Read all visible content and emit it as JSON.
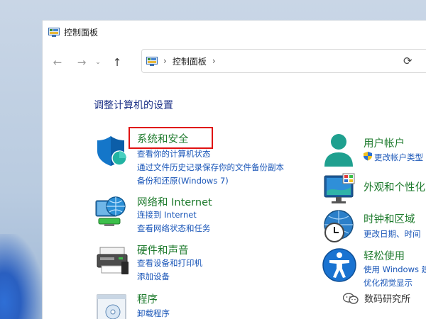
{
  "window": {
    "title": "控制面板"
  },
  "addressbar": {
    "crumb": "控制面板"
  },
  "main": {
    "heading": "调整计算机的设置"
  },
  "categories_left": [
    {
      "title": "系统和安全",
      "links": [
        "查看你的计算机状态",
        "通过文件历史记录保存你的文件备份副本",
        "备份和还原(Windows 7)"
      ]
    },
    {
      "title": "网络和 Internet",
      "links": [
        "连接到 Internet",
        "查看网络状态和任务"
      ]
    },
    {
      "title": "硬件和声音",
      "links": [
        "查看设备和打印机",
        "添加设备"
      ]
    },
    {
      "title": "程序",
      "links": [
        "卸载程序"
      ]
    }
  ],
  "categories_right": [
    {
      "title": "用户帐户",
      "links": [
        "更改帐户类型"
      ]
    },
    {
      "title": "外观和个性化",
      "links": []
    },
    {
      "title": "时钟和区域",
      "links": [
        "更改日期、时间"
      ]
    },
    {
      "title": "轻松使用",
      "links": [
        "使用 Windows 建",
        "优化视觉显示"
      ]
    }
  ],
  "watermark": {
    "text": "数码研究所"
  },
  "colors": {
    "category_title": "#1d7a2c",
    "link": "#1a56b8",
    "heading": "#1e3287",
    "highlight": "#e01212"
  },
  "icons": [
    "control-panel-icon",
    "back-arrow-icon",
    "forward-arrow-icon",
    "recent-locations-icon",
    "up-arrow-icon",
    "refresh-icon",
    "shield-icon",
    "network-globe-icon",
    "printer-icon",
    "programs-icon",
    "user-icon",
    "monitor-icon",
    "clock-globe-icon",
    "accessibility-icon",
    "wechat-icon"
  ]
}
